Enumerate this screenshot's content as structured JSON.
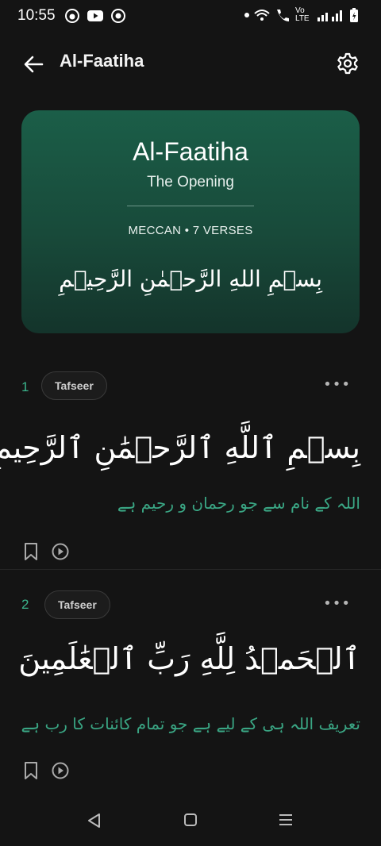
{
  "status_bar": {
    "time": "10:55",
    "net_label": "Vo LTE",
    "icons": [
      "notification-icon",
      "youtube-icon",
      "media-icon",
      "wifi-icon",
      "call-icon",
      "signal-icon",
      "battery-icon"
    ]
  },
  "app_bar": {
    "title": "Al-Faatiha"
  },
  "surah_card": {
    "name": "Al-Faatiha",
    "translation": "The Opening",
    "meta": "MECCAN • 7 VERSES",
    "bismillah": "بِسۡمِ اللهِ الرَّحۡمٰنِ الرَّحِيۡمِ",
    "gradient_top": "#1b5e48",
    "gradient_bottom": "#14342b"
  },
  "verses": [
    {
      "number": "1",
      "chip": "Tafseer",
      "arabic": "بِسۡمِ ٱللَّهِ ٱلرَّحۡمَٰنِ ٱلرَّحِيمِ",
      "urdu": "اللہ کے نام سے جو رحمان و رحیم ہے"
    },
    {
      "number": "2",
      "chip": "Tafseer",
      "arabic": "ٱلۡحَمۡدُ لِلَّهِ رَبِّ ٱلۡعَٰلَمِينَ",
      "urdu": "تعریف اللہ ہی کے لیے ہے جو تمام کائنات کا رب ہے"
    }
  ],
  "accent_color": "#3bb48c",
  "more_label": "•••"
}
